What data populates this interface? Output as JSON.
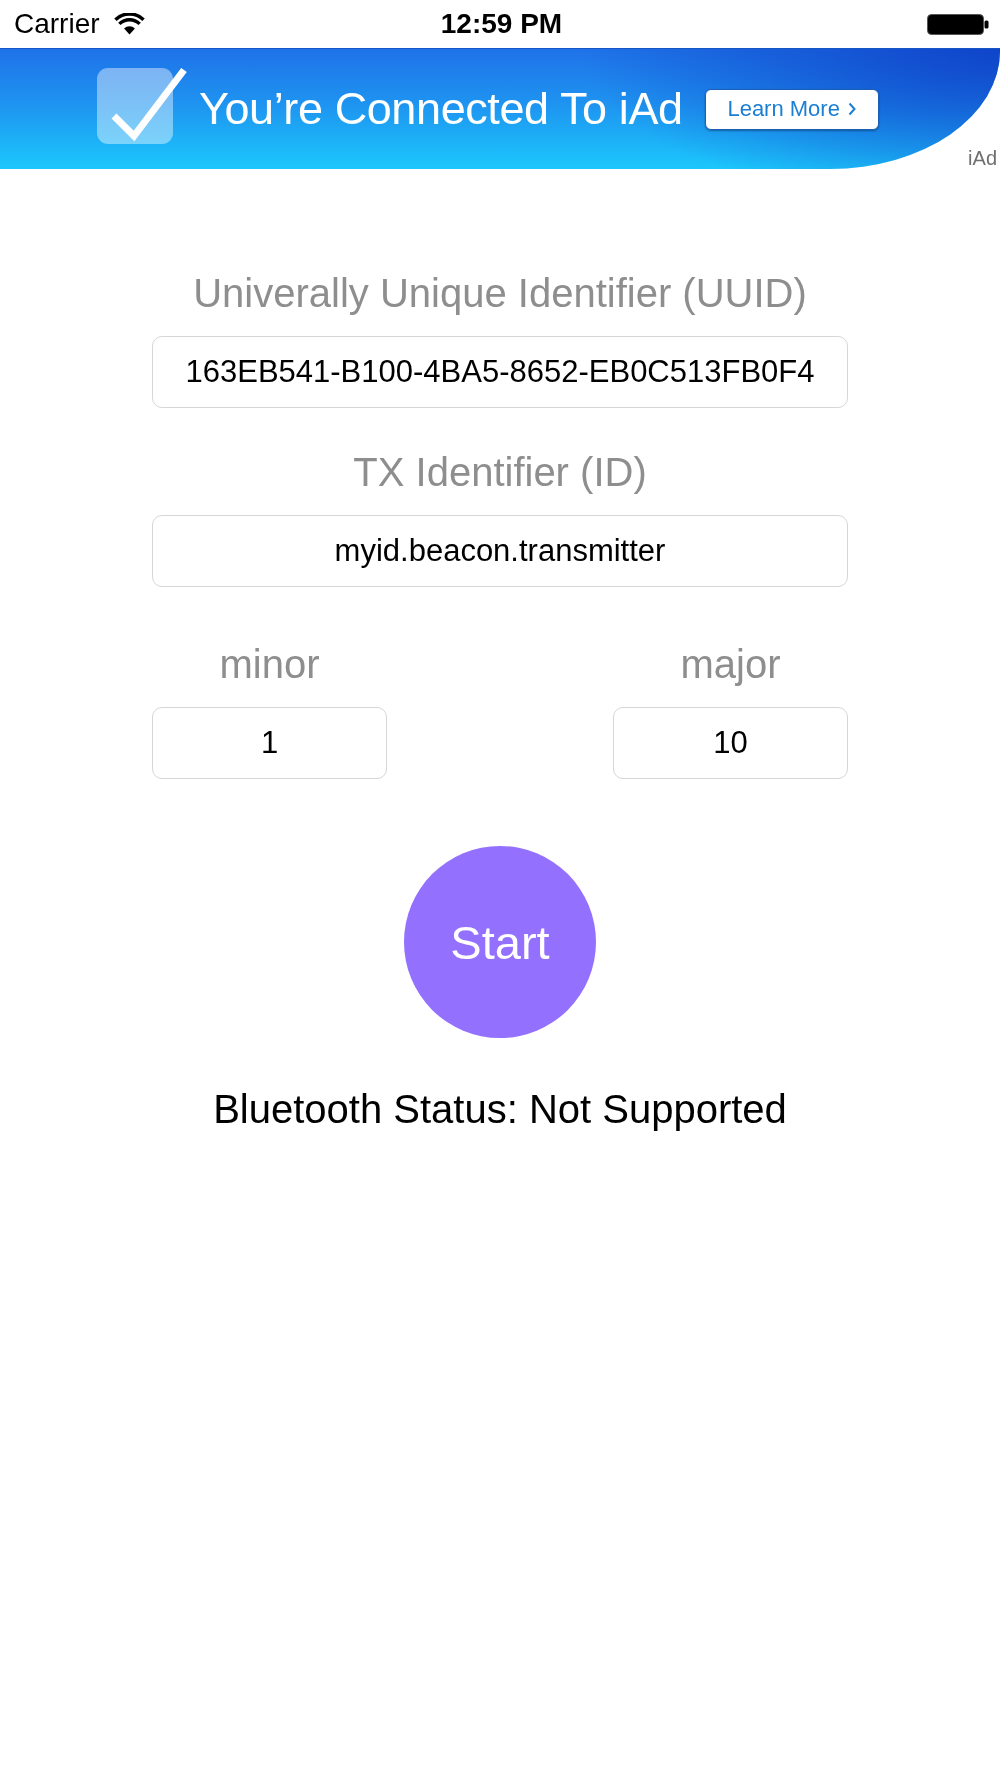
{
  "status_bar": {
    "carrier": "Carrier",
    "time": "12:59 PM"
  },
  "ad_banner": {
    "headline": "You’re Connected To iAd",
    "button": "Learn More",
    "badge": "iAd"
  },
  "form": {
    "rows": [
      {
        "fields": [
          {
            "label": "Univerally Unique Identifier (UUID)",
            "value": "163EB541-B100-4BA5-8652-EB0C513FB0F4"
          }
        ]
      },
      {
        "fields": [
          {
            "label": "TX Identifier (ID)",
            "value": "myid.beacon.transmitter"
          }
        ]
      },
      {
        "fields": [
          {
            "label": "minor",
            "value": "1"
          },
          {
            "label": "major",
            "value": "10"
          }
        ]
      }
    ]
  },
  "start_button": {
    "label": "Start"
  },
  "bluetooth_status": "Bluetooth Status: Not Supported"
}
